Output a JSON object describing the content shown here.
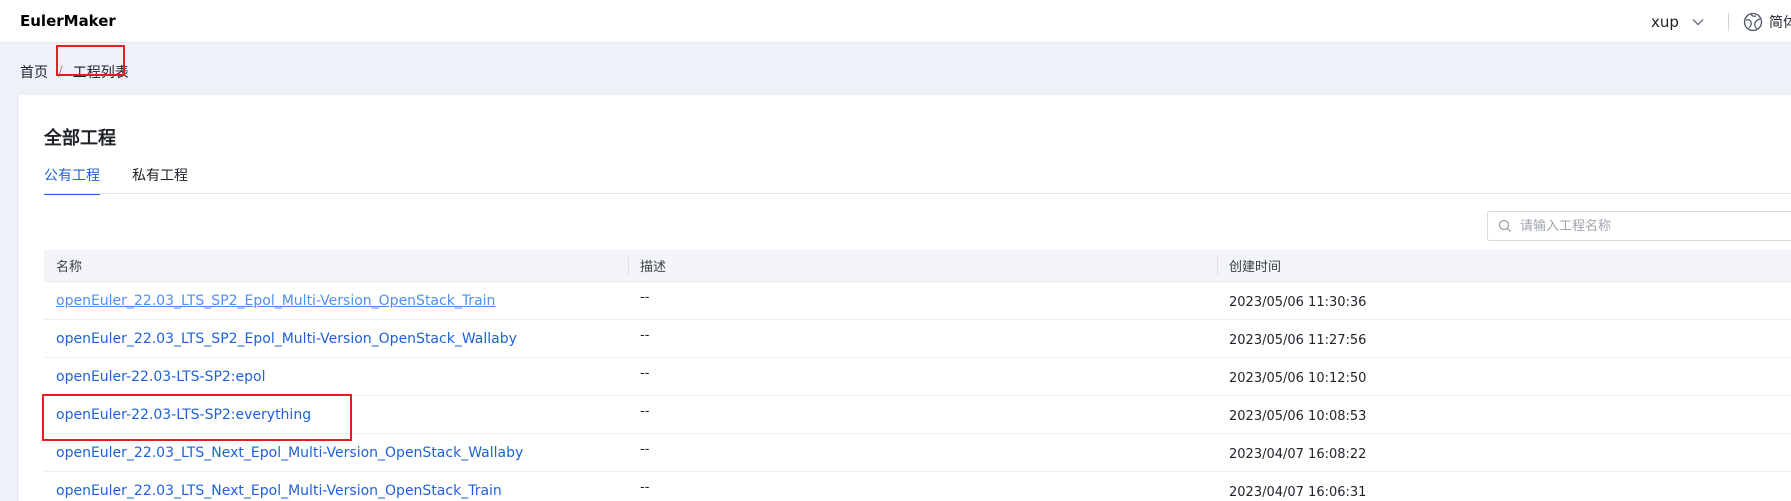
{
  "header": {
    "brand": "EulerMaker",
    "user": "xup",
    "language": "简体中文"
  },
  "breadcrumb": {
    "home": "首页",
    "separator": "/",
    "current": "工程列表"
  },
  "panel": {
    "title": "全部工程",
    "tabs": [
      {
        "label": "公有工程",
        "active": true
      },
      {
        "label": "私有工程",
        "active": false
      }
    ],
    "search": {
      "placeholder": "请输入工程名称",
      "value": ""
    }
  },
  "table": {
    "columns": [
      "名称",
      "描述",
      "创建时间"
    ],
    "rows": [
      {
        "name": "openEuler_22.03_LTS_SP2_Epol_Multi-Version_OpenStack_Train",
        "desc": "--",
        "time": "2023/05/06 11:30:36"
      },
      {
        "name": "openEuler_22.03_LTS_SP2_Epol_Multi-Version_OpenStack_Wallaby",
        "desc": "--",
        "time": "2023/05/06 11:27:56"
      },
      {
        "name": "openEuler-22.03-LTS-SP2:epol",
        "desc": "--",
        "time": "2023/05/06 10:12:50"
      },
      {
        "name": "openEuler-22.03-LTS-SP2:everything",
        "desc": "--",
        "time": "2023/05/06 10:08:53"
      },
      {
        "name": "openEuler_22.03_LTS_Next_Epol_Multi-Version_OpenStack_Wallaby",
        "desc": "--",
        "time": "2023/04/07 16:08:22"
      },
      {
        "name": "openEuler_22.03_LTS_Next_Epol_Multi-Version_OpenStack_Train",
        "desc": "--",
        "time": "2023/04/07 16:06:31"
      }
    ]
  },
  "colors": {
    "accent": "#1e62d6",
    "highlight": "#e02020",
    "background": "#eef1f7"
  }
}
